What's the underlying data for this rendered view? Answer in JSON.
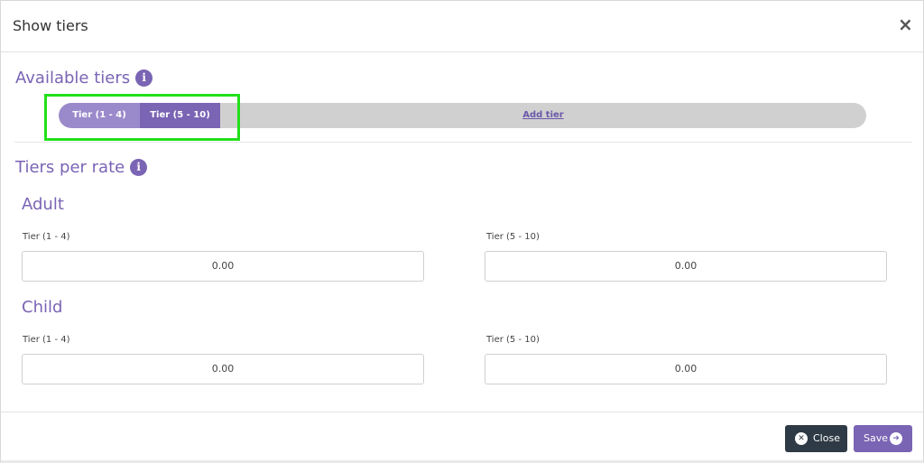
{
  "modal": {
    "title": "Show tiers",
    "close_icon": "×"
  },
  "available_tiers": {
    "title": "Available tiers",
    "info_icon": "i",
    "tiers": [
      {
        "label": "Tier (1 - 4)"
      },
      {
        "label": "Tier (5 - 10)"
      }
    ],
    "add_tier_label": "Add tier"
  },
  "tiers_per_rate": {
    "title": "Tiers per rate",
    "info_icon": "i",
    "groups": [
      {
        "name": "Adult",
        "fields": [
          {
            "label": "Tier (1 - 4)",
            "value": "0.00"
          },
          {
            "label": "Tier (5 - 10)",
            "value": "0.00"
          }
        ]
      },
      {
        "name": "Child",
        "fields": [
          {
            "label": "Tier (1 - 4)",
            "value": "0.00"
          },
          {
            "label": "Tier (5 - 10)",
            "value": "0.00"
          }
        ]
      }
    ]
  },
  "footer": {
    "close_label": "Close",
    "close_icon": "x-circle-icon",
    "save_label": "Save",
    "save_icon": "arrow-right-circle-icon"
  },
  "colors": {
    "accent": "#7a64b4",
    "accent_light": "#9b8acb",
    "bar_bg": "#d0d0d0",
    "close_button": "#2e3a45",
    "highlight": "#22e01a"
  }
}
